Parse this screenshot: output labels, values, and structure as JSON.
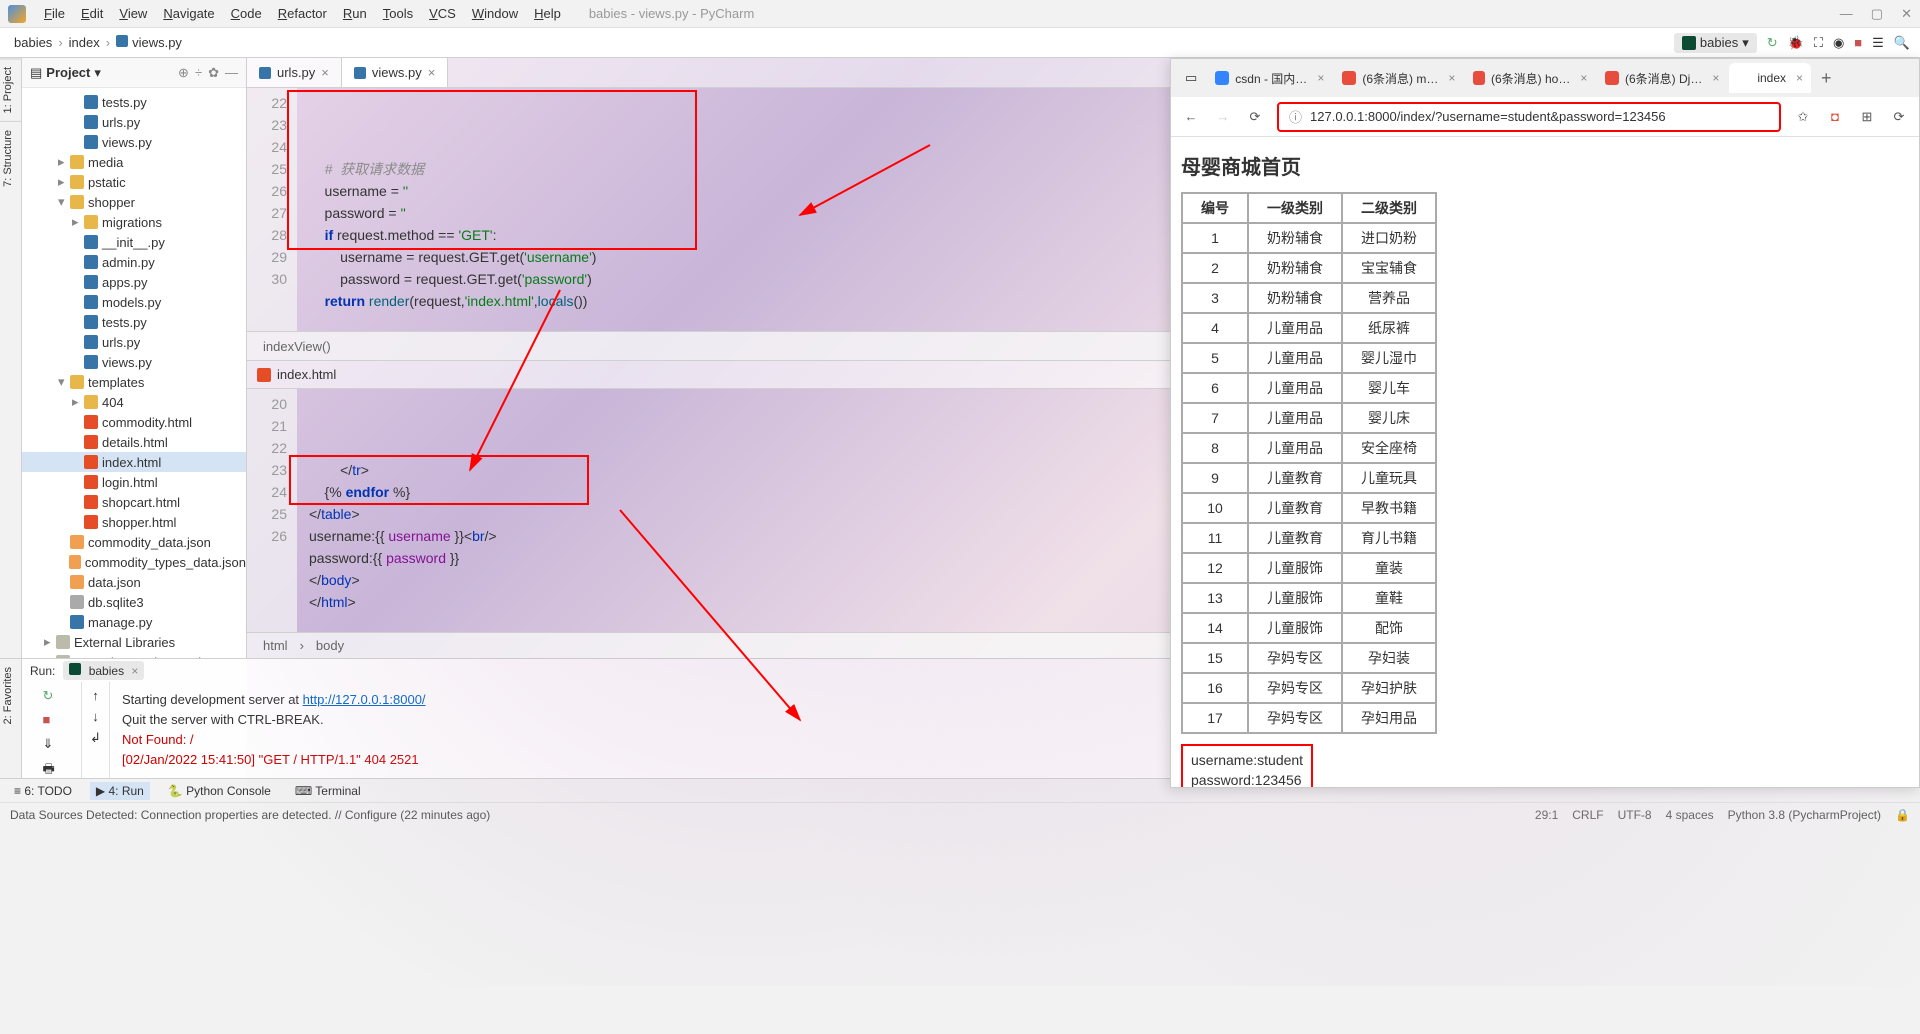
{
  "menubar": {
    "items": [
      "File",
      "Edit",
      "View",
      "Navigate",
      "Code",
      "Refactor",
      "Run",
      "Tools",
      "VCS",
      "Window",
      "Help"
    ],
    "title": "babies - views.py - PyCharm"
  },
  "breadcrumb": {
    "parts": [
      "babies",
      "index",
      "views.py"
    ],
    "project_badge": "babies"
  },
  "left_tabs": [
    "1: Project",
    "7: Structure"
  ],
  "project": {
    "header": "Project",
    "tree": [
      {
        "d": 3,
        "t": "tests.py",
        "i": "py"
      },
      {
        "d": 3,
        "t": "urls.py",
        "i": "py"
      },
      {
        "d": 3,
        "t": "views.py",
        "i": "py"
      },
      {
        "d": 2,
        "t": "media",
        "i": "folder",
        "arrow": "▸"
      },
      {
        "d": 2,
        "t": "pstatic",
        "i": "folder",
        "arrow": "▸"
      },
      {
        "d": 2,
        "t": "shopper",
        "i": "folder",
        "arrow": "▾"
      },
      {
        "d": 3,
        "t": "migrations",
        "i": "folder",
        "arrow": "▸"
      },
      {
        "d": 3,
        "t": "__init__.py",
        "i": "py"
      },
      {
        "d": 3,
        "t": "admin.py",
        "i": "py"
      },
      {
        "d": 3,
        "t": "apps.py",
        "i": "py"
      },
      {
        "d": 3,
        "t": "models.py",
        "i": "py"
      },
      {
        "d": 3,
        "t": "tests.py",
        "i": "py"
      },
      {
        "d": 3,
        "t": "urls.py",
        "i": "py"
      },
      {
        "d": 3,
        "t": "views.py",
        "i": "py"
      },
      {
        "d": 2,
        "t": "templates",
        "i": "folder",
        "arrow": "▾"
      },
      {
        "d": 3,
        "t": "404",
        "i": "folder",
        "arrow": "▸"
      },
      {
        "d": 3,
        "t": "commodity.html",
        "i": "html"
      },
      {
        "d": 3,
        "t": "details.html",
        "i": "html"
      },
      {
        "d": 3,
        "t": "index.html",
        "i": "html",
        "sel": true
      },
      {
        "d": 3,
        "t": "login.html",
        "i": "html"
      },
      {
        "d": 3,
        "t": "shopcart.html",
        "i": "html"
      },
      {
        "d": 3,
        "t": "shopper.html",
        "i": "html"
      },
      {
        "d": 2,
        "t": "commodity_data.json",
        "i": "json"
      },
      {
        "d": 2,
        "t": "commodity_types_data.json",
        "i": "json"
      },
      {
        "d": 2,
        "t": "data.json",
        "i": "json"
      },
      {
        "d": 2,
        "t": "db.sqlite3",
        "i": "db"
      },
      {
        "d": 2,
        "t": "manage.py",
        "i": "py"
      },
      {
        "d": 1,
        "t": "External Libraries",
        "i": "lib",
        "arrow": "▸"
      },
      {
        "d": 1,
        "t": "Scratches and Consoles",
        "i": "lib"
      }
    ]
  },
  "editor": {
    "tabs": [
      {
        "name": "urls.py",
        "active": false
      },
      {
        "name": "views.py",
        "active": true
      }
    ],
    "top": {
      "start": 22,
      "lines": [
        "",
        "    <span class='com'>#  获取请求数据</span>",
        "    username = <span class='str'>''</span>",
        "    password = <span class='str'>''</span>",
        "    <span class='kw'>if</span> request.method == <span class='str'>'GET'</span>:",
        "        username = request.GET.get(<span class='str'>'username'</span>)",
        "        password = request.GET.get(<span class='str'>'password'</span>)",
        "",
        "    <span class='kw'>return</span> <span class='fn'>render</span>(request,<span class='str'>'index.html'</span>,<span class='fn'>locals</span>())"
      ]
    },
    "splitter_label": "indexView()",
    "bottom_tab": "index.html",
    "bottom": {
      "start": 20,
      "lines": [
        "        &lt;/<span class='tag'>tr</span>&gt;",
        "    {% <span class='kw'>endfor</span> %}",
        "&lt;/<span class='tag'>table</span>&gt;",
        "username:{{ <span class='var'>username</span> }}&lt;<span class='tag'>br</span>/&gt;",
        "password:{{ <span class='var'>password</span> }}",
        "&lt;/<span class='tag'>body</span>&gt;",
        "&lt;/<span class='tag'>html</span>&gt;"
      ]
    },
    "breadcrumb_bottom": [
      "html",
      "body"
    ]
  },
  "run": {
    "label": "Run:",
    "config": "babies",
    "lines": [
      {
        "t": "Starting development server at ",
        "link": "http://127.0.0.1:8000/"
      },
      {
        "t": "Quit the server with CTRL-BREAK."
      },
      {
        "t": "Not Found: /",
        "red": true
      },
      {
        "t": "[02/Jan/2022 15:41:50] \"GET / HTTP/1.1\" 404 2521",
        "red": true
      }
    ]
  },
  "footer_tabs": [
    "≡ 6: TODO",
    "▶ 4: Run",
    "🐍 Python Console",
    "⌨ Terminal"
  ],
  "statusbar": {
    "message": "Data Sources Detected: Connection properties are detected. // Configure (22 minutes ago)",
    "right": [
      "29:1",
      "CRLF",
      "UTF-8",
      "4 spaces",
      "Python 3.8 (PycharmProject)",
      "🔒"
    ]
  },
  "browser": {
    "tabs": [
      {
        "name": "csdn - 国内…",
        "fav": "#3385ff"
      },
      {
        "name": "(6条消息) m…",
        "fav": "#e74c3c"
      },
      {
        "name": "(6条消息) ho…",
        "fav": "#e74c3c"
      },
      {
        "name": "(6条消息) Dj…",
        "fav": "#e74c3c"
      },
      {
        "name": "index",
        "active": true,
        "fav": "#fff"
      }
    ],
    "url": "127.0.0.1:8000/index/?username=student&password=123456",
    "heading": "母婴商城首页",
    "table": {
      "headers": [
        "编号",
        "一级类别",
        "二级类别"
      ],
      "rows": [
        [
          "1",
          "奶粉辅食",
          "进口奶粉"
        ],
        [
          "2",
          "奶粉辅食",
          "宝宝辅食"
        ],
        [
          "3",
          "奶粉辅食",
          "营养品"
        ],
        [
          "4",
          "儿童用品",
          "纸尿裤"
        ],
        [
          "5",
          "儿童用品",
          "婴儿湿巾"
        ],
        [
          "6",
          "儿童用品",
          "婴儿车"
        ],
        [
          "7",
          "儿童用品",
          "婴儿床"
        ],
        [
          "8",
          "儿童用品",
          "安全座椅"
        ],
        [
          "9",
          "儿童教育",
          "儿童玩具"
        ],
        [
          "10",
          "儿童教育",
          "早教书籍"
        ],
        [
          "11",
          "儿童教育",
          "育儿书籍"
        ],
        [
          "12",
          "儿童服饰",
          "童装"
        ],
        [
          "13",
          "儿童服饰",
          "童鞋"
        ],
        [
          "14",
          "儿童服饰",
          "配饰"
        ],
        [
          "15",
          "孕妈专区",
          "孕妇装"
        ],
        [
          "16",
          "孕妈专区",
          "孕妇护肤"
        ],
        [
          "17",
          "孕妈专区",
          "孕妇用品"
        ]
      ]
    },
    "userbox": [
      "username:student",
      "password:123456"
    ]
  },
  "left_side_fav": "2: Favorites"
}
